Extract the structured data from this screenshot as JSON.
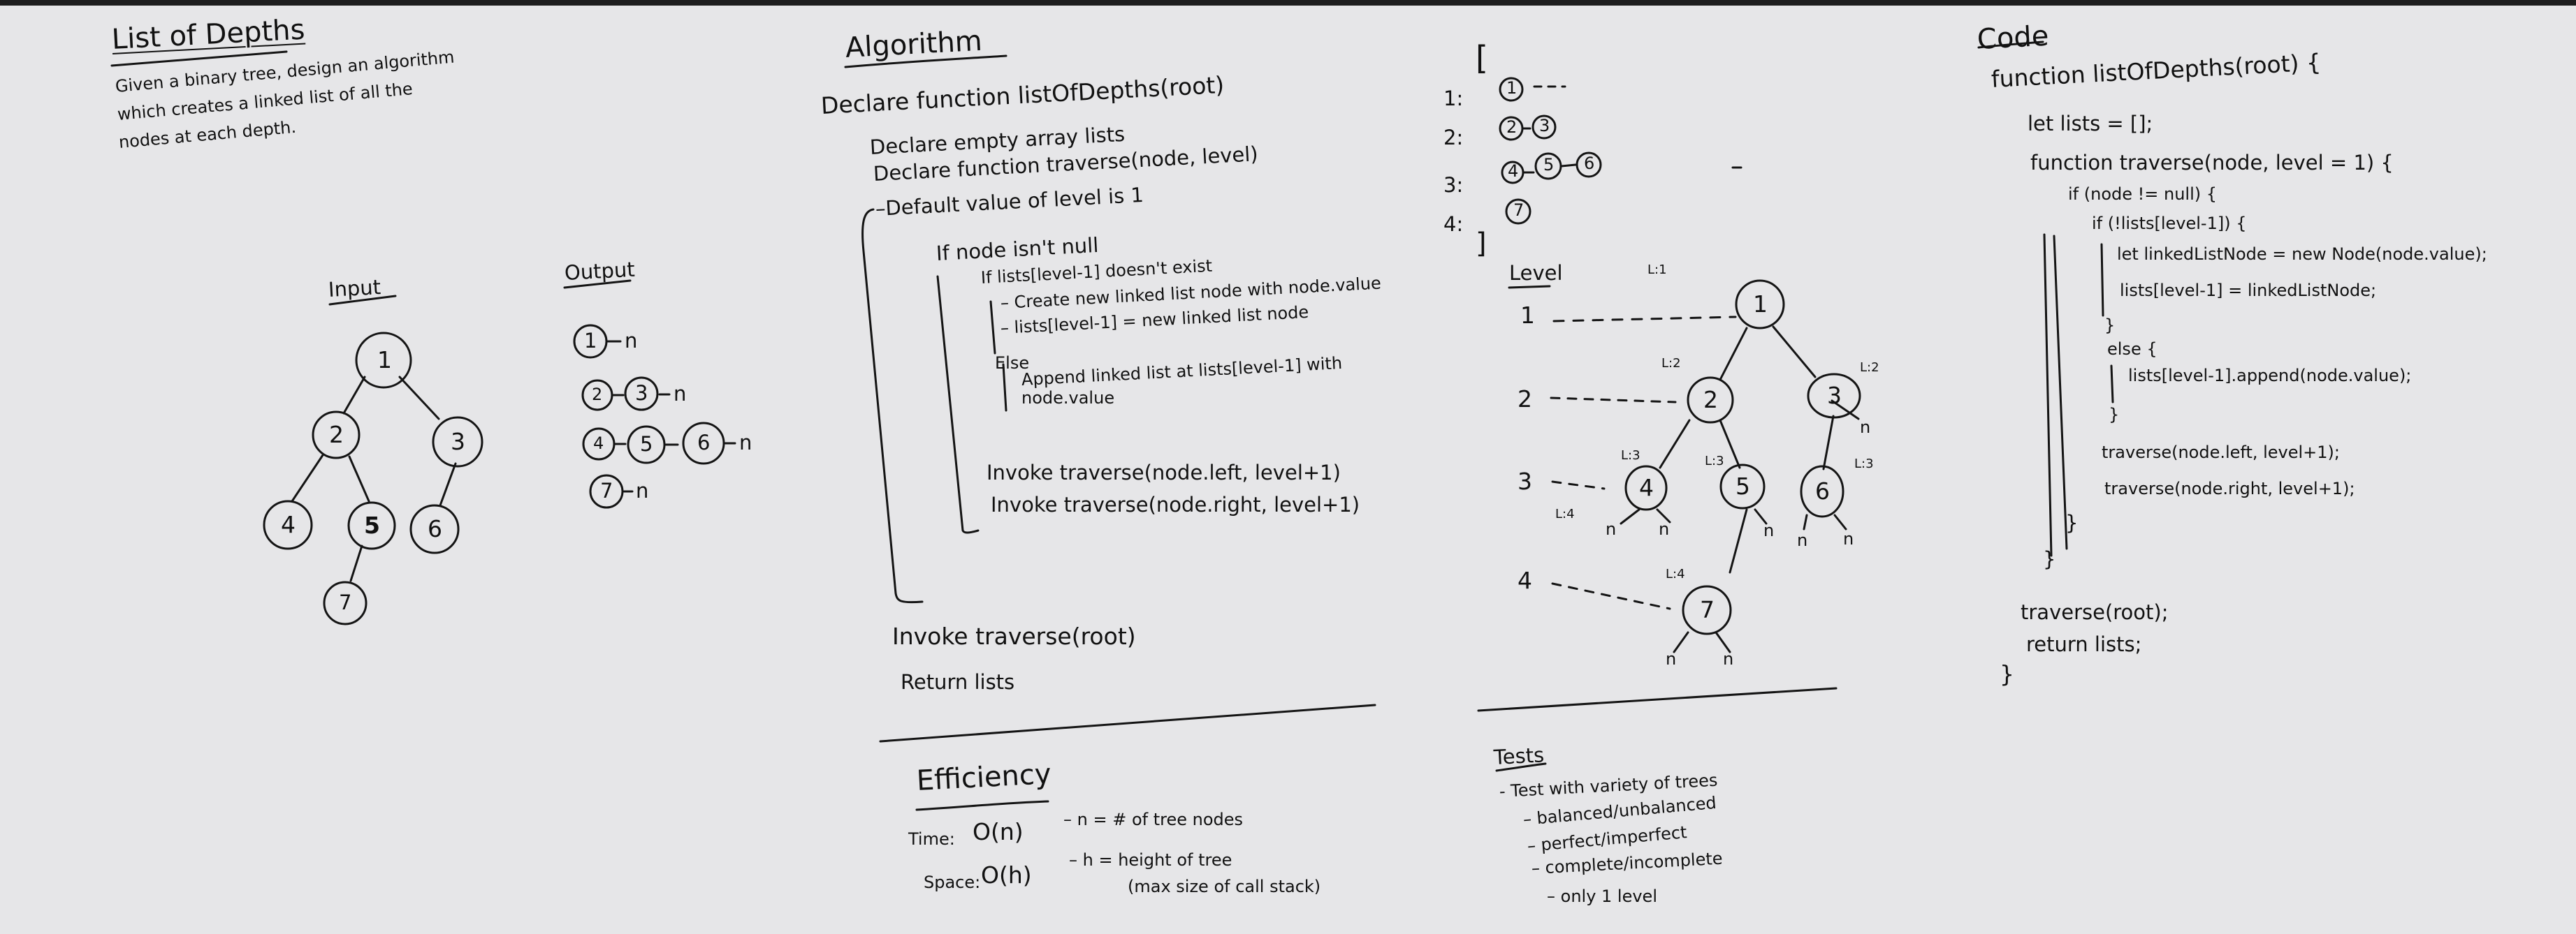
{
  "section1": {
    "title": "List of Depths",
    "prompt": [
      "Given a binary tree, design an algorithm",
      "which creates a linked list of all the",
      "nodes at each depth."
    ],
    "input_label": "Input",
    "output_label": "Output",
    "tree_nodes": [
      "1",
      "2",
      "3",
      "4",
      "5",
      "6",
      "7"
    ],
    "output_rows": [
      {
        "nodes": [
          "1"
        ],
        "end": "n"
      },
      {
        "nodes": [
          "2",
          "3"
        ],
        "end": "n"
      },
      {
        "nodes": [
          "4",
          "5",
          "6"
        ],
        "end": "n"
      },
      {
        "nodes": [
          "7"
        ],
        "end": "n"
      }
    ]
  },
  "section2": {
    "title": "Algorithm",
    "declare_fn": "Declare function listOfDepths(root)",
    "declare_lists": "Declare empty array lists",
    "declare_traverse": "Declare function traverse(node, level)",
    "default_level": "–Default value of level is 1",
    "if_node": "If node isn't null",
    "if_lists": "If lists[level-1] doesn't exist",
    "create_list": "– Create new linked list node with node.value",
    "assign_list": "– lists[level-1] = new linked list node",
    "else_label": "Else",
    "append_1": "Append linked list at lists[level-1] with",
    "append_2": "node.value",
    "invoke_left": "Invoke traverse(node.left, level+1)",
    "invoke_right": "Invoke traverse(node.right, level+1)",
    "invoke_root": "Invoke traverse(root)",
    "return_lists": "Return lists",
    "efficiency_title": "Efficiency",
    "time_label": "Time:",
    "time_value": "O(n)",
    "n_def": "– n = # of tree nodes",
    "space_label": "Space:",
    "space_value": "O(h)",
    "h_def": "– h = height of tree",
    "h_note": "(max size of call stack)"
  },
  "section3": {
    "open_bracket": "[",
    "close_bracket": "]",
    "list_rows": [
      {
        "label": "1:",
        "nodes": [
          "1"
        ],
        "tail": "– –"
      },
      {
        "label": "2:",
        "nodes": [
          "2",
          "3"
        ],
        "tail": ""
      },
      {
        "label": "3:",
        "nodes": [
          "4",
          "5",
          "6"
        ],
        "tail": ""
      },
      {
        "label": "4:",
        "nodes": [
          "7"
        ],
        "tail": ""
      }
    ],
    "level_title": "Level",
    "levels": [
      "1",
      "2",
      "3",
      "4"
    ],
    "tree_nodes": [
      "1",
      "2",
      "3",
      "4",
      "5",
      "6",
      "7"
    ],
    "null_mark": "n",
    "level_notes": [
      "L:1",
      "L:2",
      "L:2",
      "L:3",
      "L:3",
      "L:3",
      "L:4",
      "L:4"
    ],
    "tests_title": "Tests",
    "tests": [
      "- Test with variety of trees",
      "– balanced/unbalanced",
      "– perfect/imperfect",
      "– complete/incomplete",
      "– only 1 level"
    ]
  },
  "section4": {
    "title": "Code",
    "code_lines": [
      "function listOfDepths(root) {",
      "let lists = [];",
      "function traverse(node, level = 1) {",
      "if (node != null) {",
      "if (!lists[level-1]) {",
      "let linkedListNode = new Node(node.value);",
      "lists[level-1] = linkedListNode;",
      "}",
      "else {",
      "lists[level-1].append(node.value);",
      "}",
      "traverse(node.left, level+1);",
      "traverse(node.right, level+1);",
      "}",
      "}",
      "traverse(root);",
      "return lists;",
      "}"
    ]
  }
}
